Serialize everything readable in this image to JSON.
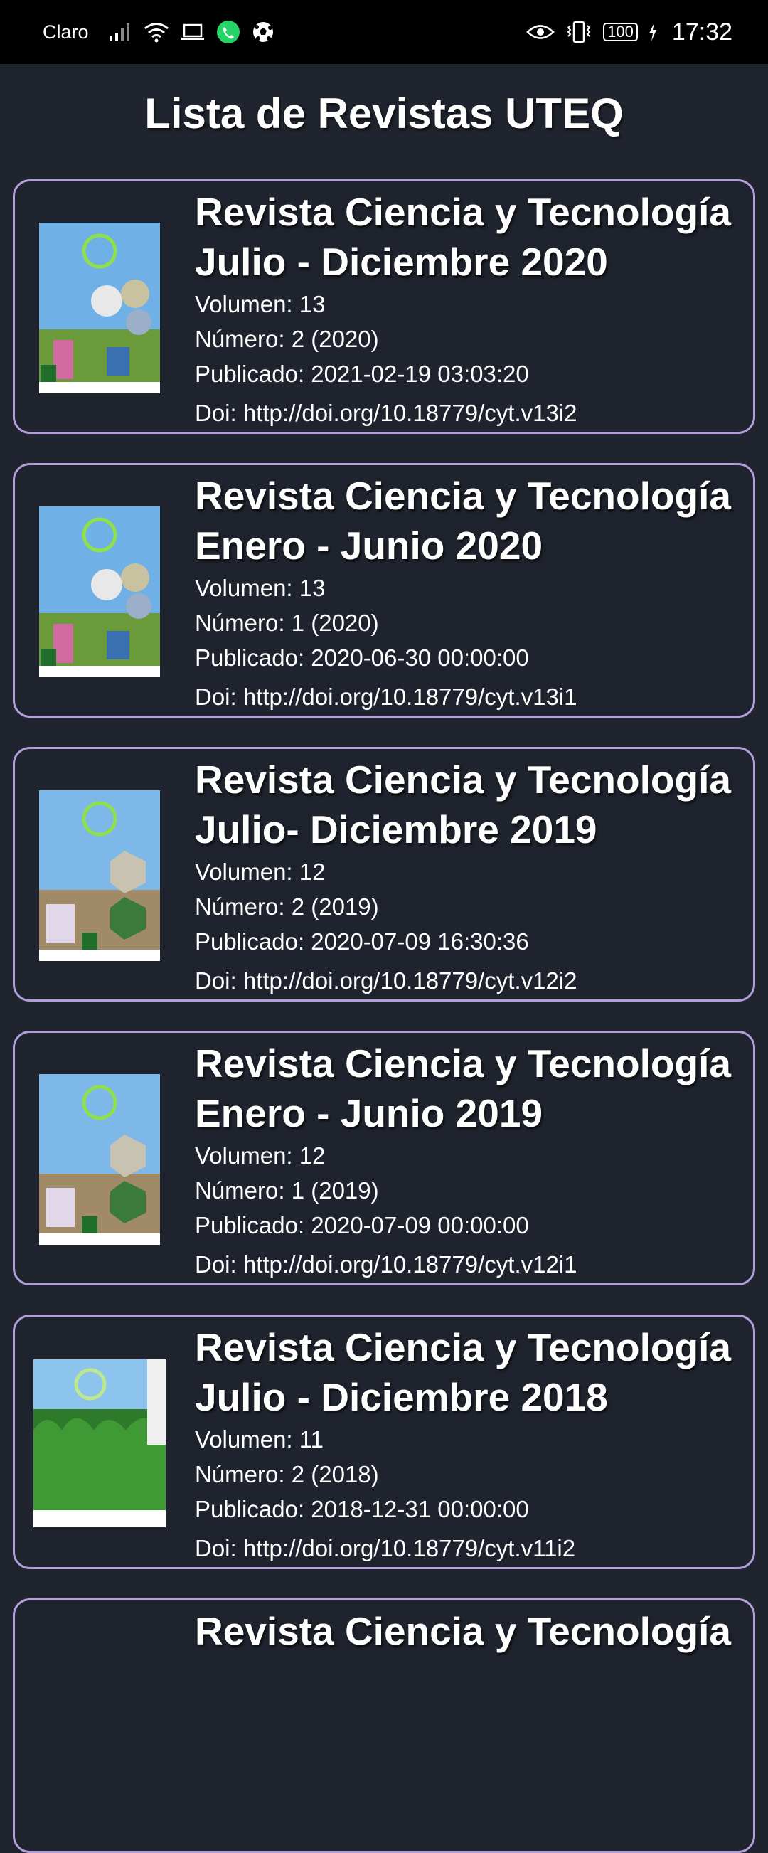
{
  "status_bar": {
    "carrier": "Claro",
    "battery": "100",
    "time": "17:32",
    "icons": [
      "signal-icon",
      "wifi-icon",
      "laptop-icon",
      "whatsapp-icon",
      "soccer-ball-icon",
      "eye-icon",
      "vibrate-icon",
      "battery-icon",
      "charging-icon"
    ]
  },
  "page": {
    "title": "Lista de Revistas UTEQ"
  },
  "journals": [
    {
      "title_line1": "Revista Ciencia y Tecnología",
      "title_line2": "Julio - Diciembre 2020",
      "volume": "Volumen: 13",
      "number": "Número: 2 (2020)",
      "published": "Publicado: 2021-02-19 03:03:20",
      "doi": "Doi: http://doi.org/10.18779/cyt.v13i2"
    },
    {
      "title_line1": "Revista Ciencia y Tecnología",
      "title_line2": "Enero - Junio 2020",
      "volume": "Volumen: 13",
      "number": "Número: 1 (2020)",
      "published": "Publicado: 2020-06-30 00:00:00",
      "doi": "Doi: http://doi.org/10.18779/cyt.v13i1"
    },
    {
      "title_line1": "Revista Ciencia y Tecnología",
      "title_line2": "Julio- Diciembre 2019",
      "volume": "Volumen: 12",
      "number": "Número: 2 (2019)",
      "published": "Publicado: 2020-07-09 16:30:36",
      "doi": "Doi: http://doi.org/10.18779/cyt.v12i2"
    },
    {
      "title_line1": "Revista Ciencia y Tecnología",
      "title_line2": "Enero - Junio 2019",
      "volume": "Volumen: 12",
      "number": "Número: 1 (2019)",
      "published": "Publicado: 2020-07-09 00:00:00",
      "doi": "Doi: http://doi.org/10.18779/cyt.v12i1"
    },
    {
      "title_line1": "Revista Ciencia y Tecnología",
      "title_line2": "Julio - Diciembre 2018",
      "volume": "Volumen: 11",
      "number": "Número: 2 (2018)",
      "published": "Publicado: 2018-12-31 00:00:00",
      "doi": "Doi: http://doi.org/10.18779/cyt.v11i2"
    },
    {
      "title_line1": "Revista Ciencia y Tecnología"
    }
  ],
  "colors": {
    "background": "#20242e",
    "card_border": "#b39ddb",
    "status_bar": "#000000",
    "whatsapp": "#25d366"
  }
}
